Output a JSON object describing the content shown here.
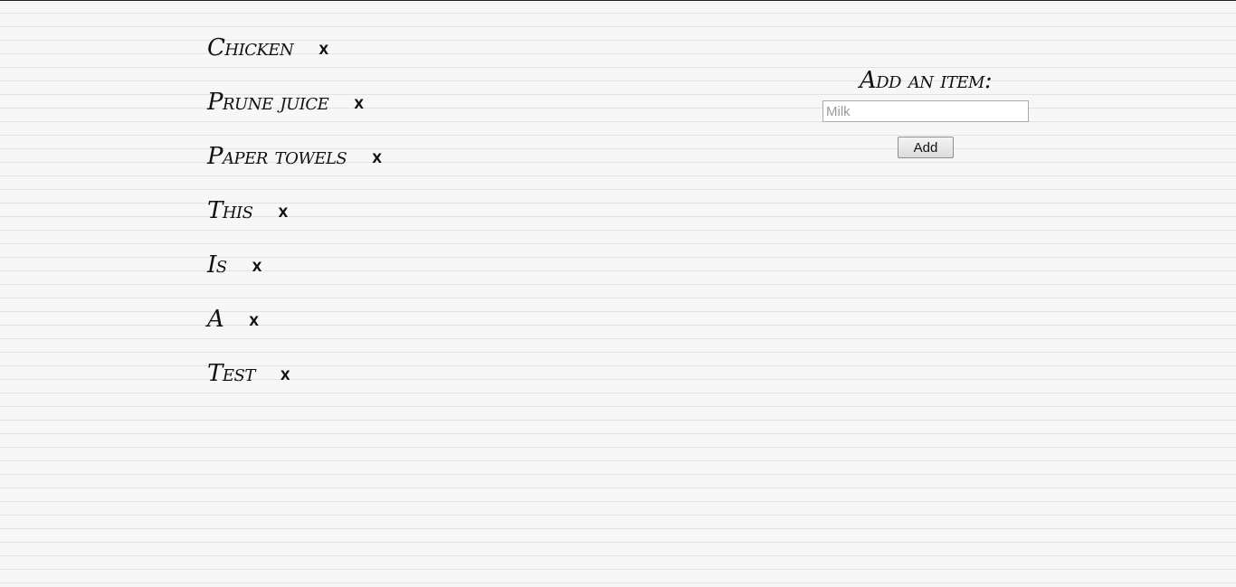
{
  "items": [
    {
      "label": "Chicken",
      "remove": "x"
    },
    {
      "label": "Prune juice",
      "remove": "x"
    },
    {
      "label": "Paper towels",
      "remove": "x"
    },
    {
      "label": "This",
      "remove": "x"
    },
    {
      "label": "Is",
      "remove": "x"
    },
    {
      "label": "A",
      "remove": "x"
    },
    {
      "label": "Test",
      "remove": "x"
    }
  ],
  "add_form": {
    "heading": "Add an item:",
    "input_placeholder": "Milk",
    "input_value": "",
    "button_label": "Add"
  },
  "colors": {
    "paper": "#f7f7f7",
    "rule_line": "#e3e3e3",
    "ink": "#111111"
  }
}
